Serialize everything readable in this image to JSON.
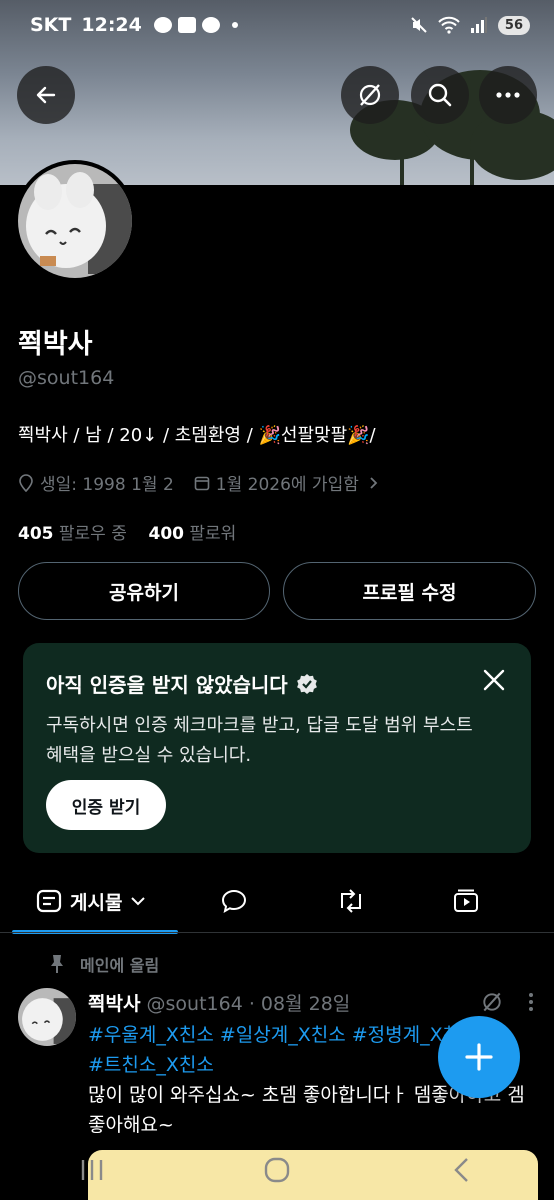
{
  "status_bar": {
    "carrier": "SKT",
    "time": "12:24",
    "battery": "56"
  },
  "profile": {
    "display_name": "쬑박사",
    "handle": "@sout164",
    "bio": "쬑박사  / 남 /  20↓ / 초뎀환영 / 🎉선팔맞팔🎉/",
    "birthday": "생일: 1998 1월 2",
    "joined": "1월 2026에 가입함",
    "following_count": "405",
    "following_label": "팔로우 중",
    "followers_count": "400",
    "followers_label": "팔로워"
  },
  "buttons": {
    "share": "공유하기",
    "edit_profile": "프로필 수정"
  },
  "verify_card": {
    "title": "아직 인증을 받지 않았습니다",
    "body": "구독하시면 인증 체크마크를 받고, 답글 도달 범위 부스트 혜택을 받으실 수 있습니다.",
    "button": "인증 받기"
  },
  "tabs": {
    "posts": "게시물"
  },
  "pinned_label": "메인에 올림",
  "post": {
    "author": "쬑박사",
    "handle": "@sout164",
    "separator": "·",
    "date": "08월 28일",
    "tags_line1": "#우울계_X친소 #일상계_X친소 #정병계_X친소",
    "tags_line2": "#트친소_X친소",
    "text": "많이 많이 와주십쇼~ 초뎀 좋아합니다ㅏ 뎀좋아하고 겜좋아해요~"
  },
  "colors": {
    "accent": "#1d9bf0",
    "background": "#000000",
    "verify_card": "#0f2a20",
    "muted": "#71767b"
  },
  "icons": [
    "back-arrow-icon",
    "grok-icon",
    "search-icon",
    "more-icon",
    "location-icon",
    "calendar-icon",
    "chevron-right-icon",
    "verified-badge-icon",
    "close-icon",
    "posts-tab-icon",
    "chevron-down-icon",
    "replies-tab-icon",
    "repost-tab-icon",
    "media-tab-icon",
    "pin-icon",
    "compose-plus-icon"
  ]
}
